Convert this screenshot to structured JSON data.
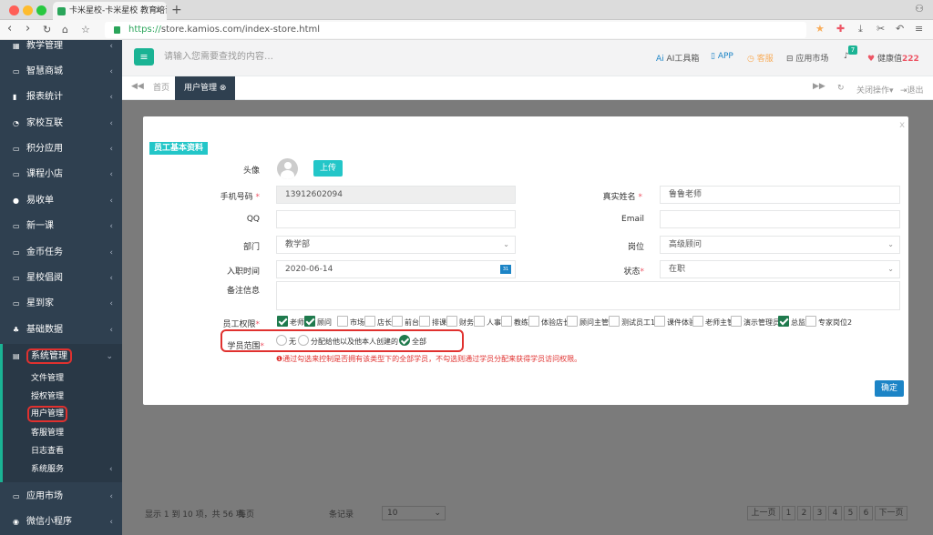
{
  "browser": {
    "tab_title": "卡米星校-卡米星校 教育培训机",
    "tab_close": "×",
    "new_tab": "+",
    "url_scheme": "https://",
    "url_rest": "store.kamios.com/index-store.html"
  },
  "sidebar": {
    "items": [
      {
        "label": "教学管理",
        "icon": "calendar-icon"
      },
      {
        "label": "智慧商城",
        "icon": "shop-icon"
      },
      {
        "label": "报表统计",
        "icon": "bar-chart-icon"
      },
      {
        "label": "家校互联",
        "icon": "chat-icon"
      },
      {
        "label": "积分应用",
        "icon": "points-icon"
      },
      {
        "label": "课程小店",
        "icon": "store-icon"
      },
      {
        "label": "易收单",
        "icon": "users-icon"
      },
      {
        "label": "新一课",
        "icon": "lesson-icon"
      },
      {
        "label": "金币任务",
        "icon": "coin-icon"
      },
      {
        "label": "星校倡阅",
        "icon": "book-icon"
      },
      {
        "label": "星到家",
        "icon": "home-icon"
      },
      {
        "label": "基础数据",
        "icon": "data-icon"
      },
      {
        "label": "系统管理",
        "icon": "settings-icon"
      },
      {
        "label": "应用市场",
        "icon": "market-icon"
      },
      {
        "label": "微信小程序",
        "icon": "wechat-icon"
      }
    ],
    "sub_items": [
      "文件管理",
      "授权管理",
      "用户管理",
      "客服管理",
      "日志查看",
      "系统服务"
    ]
  },
  "header": {
    "menu_icon": "≡",
    "search_placeholder": "请输入您需要查找的内容…",
    "ai_tools": "AI工具箱",
    "app": "APP",
    "service": "客服",
    "app_market": "应用市场",
    "bell_badge": "7",
    "health_label": "健康值",
    "health_value": "222"
  },
  "tabs": {
    "home": "首页",
    "user_mgmt": "用户管理",
    "close_ops": "关闭操作",
    "logout": "退出"
  },
  "modal": {
    "section_title": "员工基本资料",
    "avatar_label": "头像",
    "upload": "上传",
    "phone_label": "手机号码",
    "phone_value": "13912602094",
    "realname_label": "真实姓名",
    "realname_value": "鲁鲁老师",
    "qq_label": "QQ",
    "email_label": "Email",
    "dept_label": "部门",
    "dept_value": "教学部",
    "post_label": "岗位",
    "post_value": "高级顾问",
    "join_label": "入职时间",
    "join_value": "2020-06-14",
    "status_label": "状态",
    "status_value": "在职",
    "remark_label": "备注信息",
    "perm_label": "员工权限",
    "permissions": [
      {
        "label": "老师",
        "checked": true
      },
      {
        "label": "顾问",
        "checked": true
      },
      {
        "label": "市场",
        "checked": false
      },
      {
        "label": "店长",
        "checked": false
      },
      {
        "label": "前台",
        "checked": false
      },
      {
        "label": "排课",
        "checked": false
      },
      {
        "label": "财务",
        "checked": false
      },
      {
        "label": "人事",
        "checked": false
      },
      {
        "label": "教练",
        "checked": false
      },
      {
        "label": "体验店长",
        "checked": false
      },
      {
        "label": "顾问主管",
        "checked": false
      },
      {
        "label": "测试员工1",
        "checked": false
      },
      {
        "label": "课件体验",
        "checked": false
      },
      {
        "label": "老师主管",
        "checked": false
      },
      {
        "label": "演示管理员",
        "checked": false
      },
      {
        "label": "总监",
        "checked": true
      },
      {
        "label": "专家岗位2",
        "checked": false
      }
    ],
    "scope_label": "学员范围",
    "scope_options": [
      {
        "label": "无",
        "checked": false
      },
      {
        "label": "分配给他以及他本人创建的",
        "checked": false
      },
      {
        "label": "全部",
        "checked": true
      }
    ],
    "warning": "❶通过勾选来控制是否拥有该类型下的全部学员，不勾选则通过学员分配来获得学员访问权限。",
    "confirm": "确定",
    "close": "x"
  },
  "list_footer": {
    "summary": "显示 1 到 10 项，共 56 项",
    "per_page_label": "每页",
    "per_page_value": "10",
    "records": "条记录",
    "prev": "上一页",
    "pages": [
      "1",
      "2",
      "3",
      "4",
      "5",
      "6"
    ],
    "next": "下一页"
  },
  "colors": {
    "sidebar": "#2f4050",
    "accent": "#1ab394",
    "highlight_red": "#e0312f",
    "primary": "#1c84c6"
  }
}
